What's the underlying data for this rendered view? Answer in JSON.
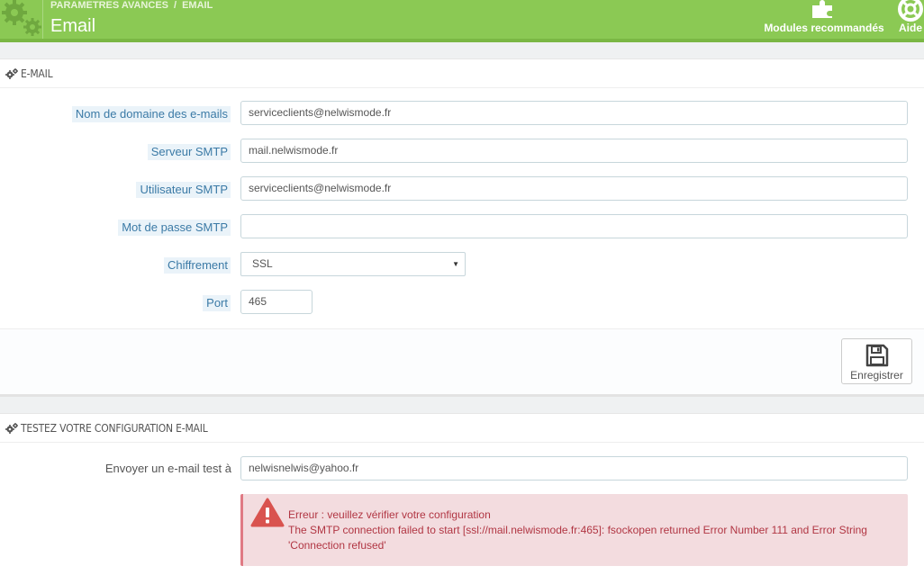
{
  "header": {
    "breadcrumb": [
      "PARAMETRES AVANCES",
      "EMAIL"
    ],
    "breadcrumb_sep": "/",
    "title": "Email",
    "toolbar": {
      "modules_label": "Modules recommandés",
      "help_label": "Aide"
    },
    "colors": {
      "header_bg": "#8bc954",
      "label_bg": "#eaf3f9",
      "label_text": "#3b7aa6",
      "error_bg": "#f3dcdf",
      "error_text": "#b13643"
    }
  },
  "email_panel": {
    "heading": "E-MAIL",
    "fields": {
      "domain": {
        "label": "Nom de domaine des e-mails",
        "value": "serviceclients@nelwismode.fr"
      },
      "smtp_server": {
        "label": "Serveur SMTP",
        "value": "mail.nelwismode.fr"
      },
      "smtp_user": {
        "label": "Utilisateur SMTP",
        "value": "serviceclients@nelwismode.fr"
      },
      "smtp_password": {
        "label": "Mot de passe SMTP",
        "value": ""
      },
      "encryption": {
        "label": "Chiffrement",
        "value": "SSL"
      },
      "port": {
        "label": "Port",
        "value": "465"
      }
    },
    "save_label": "Enregistrer"
  },
  "test_panel": {
    "heading": "TESTEZ VOTRE CONFIGURATION E-MAIL",
    "send_label": "Envoyer un e-mail test à",
    "send_value": "nelwisnelwis@yahoo.fr",
    "error": {
      "title": "Erreur : veuillez vérifier votre configuration",
      "message": "The SMTP connection failed to start [ssl://mail.nelwismode.fr:465]: fsockopen returned Error Number 111 and Error String 'Connection refused'"
    }
  }
}
